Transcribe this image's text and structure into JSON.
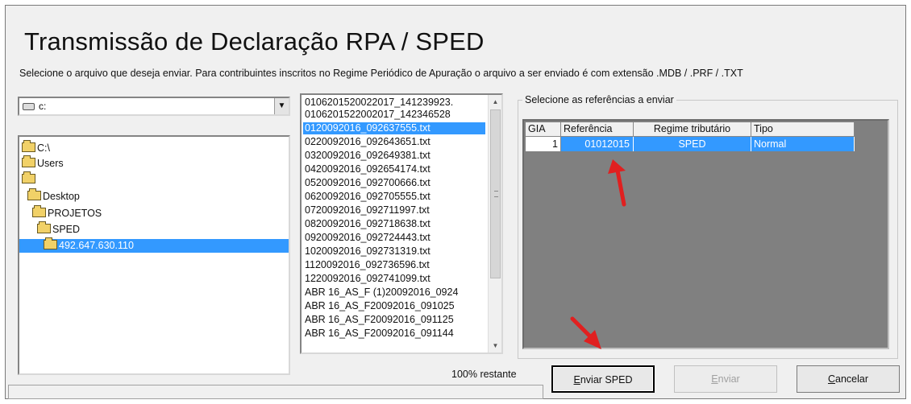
{
  "header": {
    "title": "Transmissão de Declaração RPA / SPED",
    "subtitle": "Selecione o arquivo que deseja enviar. Para contribuintes inscritos no Regime Periódico de Apuração o arquivo a ser enviado é com extensão .MDB / .PRF / .TXT"
  },
  "drive": {
    "value": "c:",
    "icon": "drive-icon"
  },
  "folders": [
    {
      "label": "C:\\"
    },
    {
      "label": "Users"
    },
    {
      "label": ""
    },
    {
      "label": "Desktop"
    },
    {
      "label": "PROJETOS"
    },
    {
      "label": "SPED"
    },
    {
      "label": "492.647.630.110"
    }
  ],
  "files": [
    {
      "label": "0106201520022017_141239923."
    },
    {
      "label": "0106201522002017_142346528"
    },
    {
      "label": "0120092016_092637555.txt"
    },
    {
      "label": "0220092016_092643651.txt"
    },
    {
      "label": "0320092016_092649381.txt"
    },
    {
      "label": "0420092016_092654174.txt"
    },
    {
      "label": "0520092016_092700666.txt"
    },
    {
      "label": "0620092016_092705555.txt"
    },
    {
      "label": "0720092016_092711997.txt"
    },
    {
      "label": "0820092016_092718638.txt"
    },
    {
      "label": "0920092016_092724443.txt"
    },
    {
      "label": "1020092016_092731319.txt"
    },
    {
      "label": "1120092016_092736596.txt"
    },
    {
      "label": "1220092016_092741099.txt"
    },
    {
      "label": "ABR 16_AS_F (1)20092016_0924"
    },
    {
      "label": "ABR 16_AS_F20092016_091025"
    },
    {
      "label": "ABR 16_AS_F20092016_091125"
    },
    {
      "label": "ABR 16_AS_F20092016_091144"
    }
  ],
  "references": {
    "legend": "Selecione as referências a enviar",
    "columns": [
      "GIA",
      "Referência",
      "Regime tributário",
      "Tipo"
    ],
    "rows": [
      {
        "gia": "1",
        "referencia": "01012015",
        "regime": "SPED",
        "tipo": "Normal"
      }
    ]
  },
  "status": {
    "text": "100% restante",
    "progress": 0
  },
  "buttons": {
    "enviar_sped_accel": "E",
    "enviar_sped_rest": "nviar SPED",
    "enviar_accel": "E",
    "enviar_rest": "nviar",
    "cancelar_accel": "C",
    "cancelar_rest": "ancelar"
  },
  "colors": {
    "selection": "#3399ff",
    "annotation_arrow": "#e02020"
  }
}
